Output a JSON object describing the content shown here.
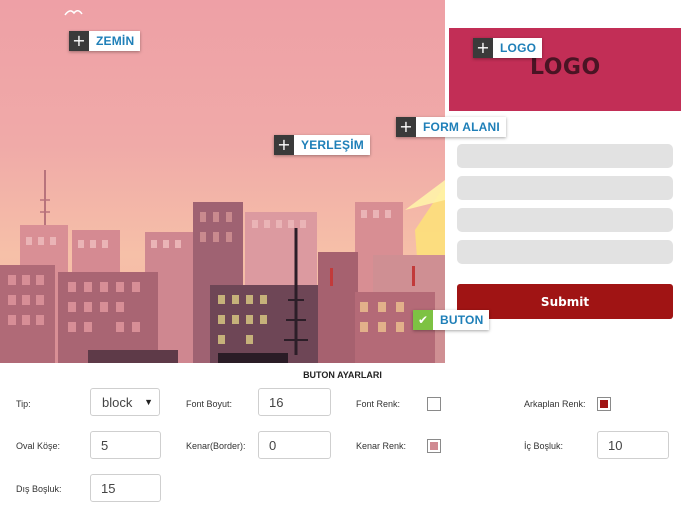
{
  "logo": {
    "text": "LOGO",
    "background": "#c22e56",
    "text_color": "#4a1424"
  },
  "form": {
    "fields": [
      "",
      "",
      "",
      ""
    ],
    "field_color": "#e2e2e2",
    "submit_label": "Submit",
    "submit_color": "#a01414"
  },
  "tags": {
    "zemin": "ZEMİN",
    "logo": "LOGO",
    "form_alani": "FORM ALANI",
    "yerlesim": "YERLEŞİM",
    "buton": "BUTON"
  },
  "icons": {
    "plus": "+",
    "check": "✔"
  },
  "settings": {
    "title": "BUTON AYARLARI",
    "tip_label": "Tip:",
    "tip_value": "block",
    "font_boyut_label": "Font Boyut:",
    "font_boyut_value": "16",
    "font_renk_label": "Font Renk:",
    "font_renk_color": "#ffffff",
    "arkaplan_renk_label": "Arkaplan Renk:",
    "arkaplan_renk_color": "#a01414",
    "oval_kose_label": "Oval Köşe:",
    "oval_kose_value": "5",
    "kenar_label": "Kenar(Border):",
    "kenar_value": "0",
    "kenar_renk_label": "Kenar Renk:",
    "kenar_renk_color": "#d08a92",
    "ic_bosluk_label": "İç Boşluk:",
    "ic_bosluk_value": "10",
    "dis_bosluk_label": "Dış Boşluk:",
    "dis_bosluk_value": "15"
  }
}
